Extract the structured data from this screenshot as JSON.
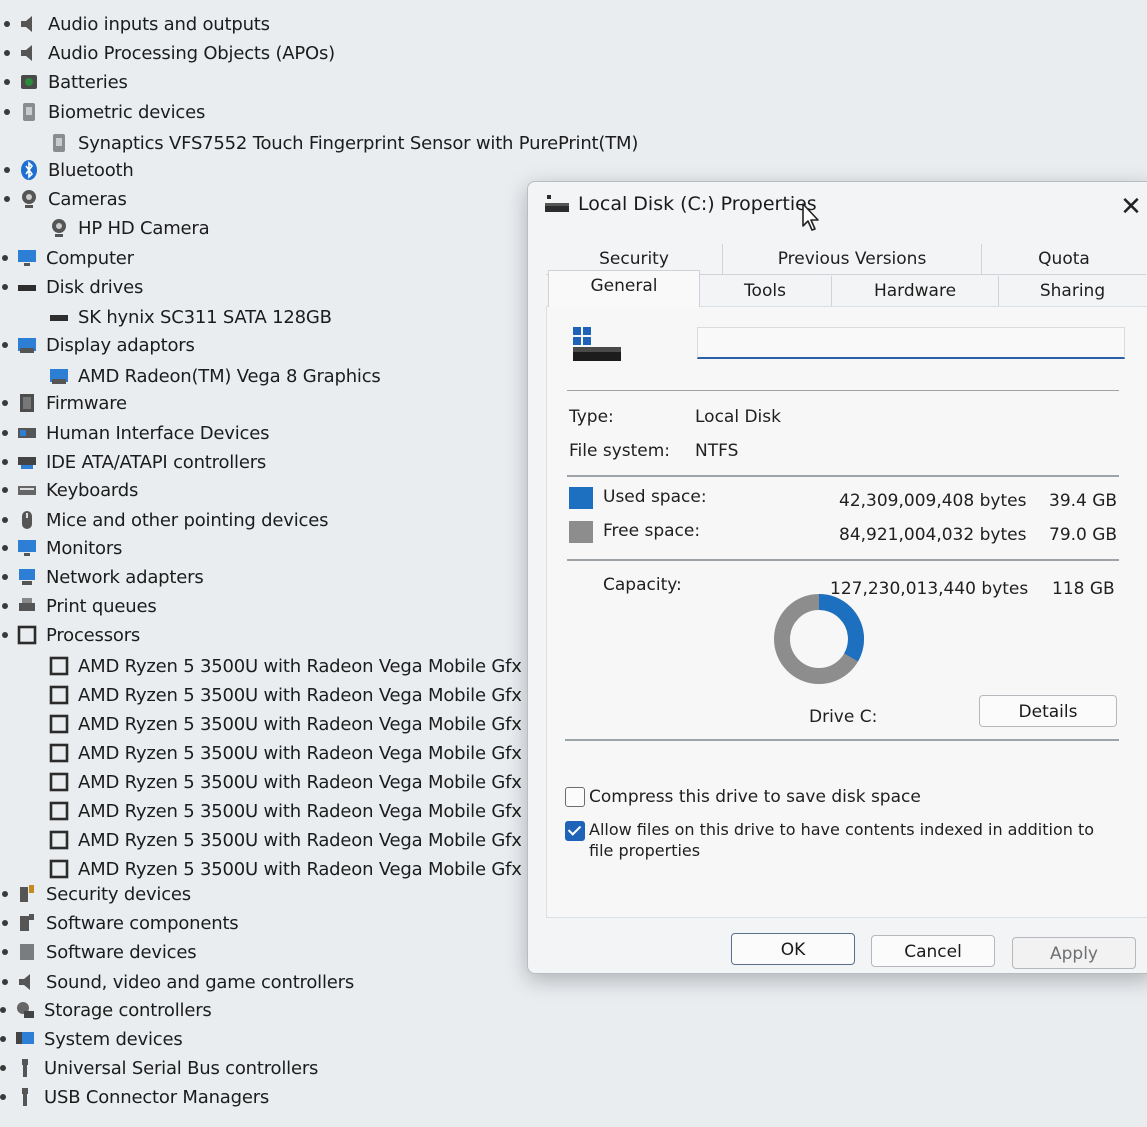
{
  "device_tree": {
    "items": [
      {
        "label": "Audio inputs and outputs",
        "icon": "speaker-icon"
      },
      {
        "label": "Audio Processing Objects (APOs)",
        "icon": "speaker-icon"
      },
      {
        "label": "Batteries",
        "icon": "battery-icon"
      },
      {
        "label": "Biometric devices",
        "icon": "fingerprint-icon"
      },
      {
        "label": "Synaptics VFS7552 Touch Fingerprint Sensor with PurePrint(TM)",
        "icon": "fingerprint-icon"
      },
      {
        "label": "Bluetooth",
        "icon": "bluetooth-icon"
      },
      {
        "label": "Cameras",
        "icon": "camera-icon"
      },
      {
        "label": "HP HD Camera",
        "icon": "camera-icon"
      },
      {
        "label": "Computer",
        "icon": "monitor-icon"
      },
      {
        "label": "Disk drives",
        "icon": "disk-icon"
      },
      {
        "label": "SK hynix SC311 SATA 128GB",
        "icon": "disk-icon"
      },
      {
        "label": "Display adaptors",
        "icon": "display-adapter-icon"
      },
      {
        "label": "AMD Radeon(TM) Vega 8 Graphics",
        "icon": "display-adapter-icon"
      },
      {
        "label": "Firmware",
        "icon": "chip-icon"
      },
      {
        "label": "Human Interface Devices",
        "icon": "hid-icon"
      },
      {
        "label": "IDE ATA/ATAPI controllers",
        "icon": "ide-icon"
      },
      {
        "label": "Keyboards",
        "icon": "keyboard-icon"
      },
      {
        "label": "Mice and other pointing devices",
        "icon": "mouse-icon"
      },
      {
        "label": "Monitors",
        "icon": "monitor-icon"
      },
      {
        "label": "Network adapters",
        "icon": "network-icon"
      },
      {
        "label": "Print queues",
        "icon": "printer-icon"
      },
      {
        "label": "Processors",
        "icon": "processor-icon"
      },
      {
        "label": "AMD Ryzen 5 3500U with Radeon Vega Mobile Gfx",
        "icon": "processor-icon"
      },
      {
        "label": "AMD Ryzen 5 3500U with Radeon Vega Mobile Gfx",
        "icon": "processor-icon"
      },
      {
        "label": "AMD Ryzen 5 3500U with Radeon Vega Mobile Gfx",
        "icon": "processor-icon"
      },
      {
        "label": "AMD Ryzen 5 3500U with Radeon Vega Mobile Gfx",
        "icon": "processor-icon"
      },
      {
        "label": "AMD Ryzen 5 3500U with Radeon Vega Mobile Gfx",
        "icon": "processor-icon"
      },
      {
        "label": "AMD Ryzen 5 3500U with Radeon Vega Mobile Gfx",
        "icon": "processor-icon"
      },
      {
        "label": "AMD Ryzen 5 3500U with Radeon Vega Mobile Gfx",
        "icon": "processor-icon"
      },
      {
        "label": "AMD Ryzen 5 3500U with Radeon Vega Mobile Gfx",
        "icon": "processor-icon"
      },
      {
        "label": "Security devices",
        "icon": "security-icon"
      },
      {
        "label": "Software components",
        "icon": "software-icon"
      },
      {
        "label": "Software devices",
        "icon": "software-device-icon"
      },
      {
        "label": "Sound, video and game controllers",
        "icon": "speaker-icon"
      },
      {
        "label": "Storage controllers",
        "icon": "storage-icon"
      },
      {
        "label": "System devices",
        "icon": "system-icon"
      },
      {
        "label": "Universal Serial Bus controllers",
        "icon": "usb-icon"
      },
      {
        "label": "USB Connector Managers",
        "icon": "usb-icon"
      }
    ]
  },
  "dialog": {
    "title": "Local Disk (C:) Properties",
    "close_label": "✕",
    "tabs_row1": [
      "Security",
      "Previous Versions",
      "Quota"
    ],
    "tabs_row2": [
      "General",
      "Tools",
      "Hardware",
      "Sharing"
    ],
    "active_tab": "General",
    "volume_name_value": "",
    "type_label": "Type:",
    "type_value": "Local Disk",
    "fs_label": "File system:",
    "fs_value": "NTFS",
    "used_label": "Used space:",
    "used_bytes": "42,309,009,408 bytes",
    "used_gb": "39.4 GB",
    "free_label": "Free space:",
    "free_bytes": "84,921,004,032 bytes",
    "free_gb": "79.0 GB",
    "capacity_label": "Capacity:",
    "capacity_bytes": "127,230,013,440 bytes",
    "capacity_gb": "118 GB",
    "drive_label": "Drive C:",
    "details_label": "Details",
    "compress_label": "Compress this drive to save disk space",
    "compress_checked": false,
    "index_label": "Allow files on this drive to have contents indexed in addition to file properties",
    "index_checked": true,
    "ok_label": "OK",
    "cancel_label": "Cancel",
    "apply_label": "Apply",
    "used_fraction": 0.3325,
    "colors": {
      "used": "#1d6fc0",
      "free": "#8d8d8d",
      "accent": "#1f63b8"
    }
  }
}
